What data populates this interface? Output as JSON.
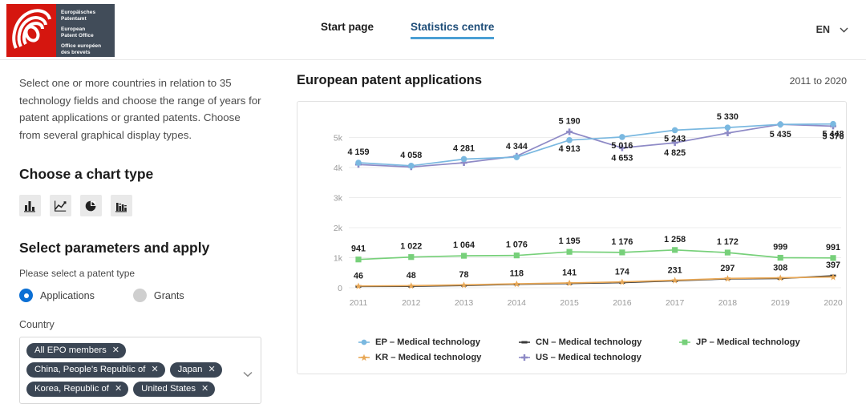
{
  "header": {
    "logo": {
      "line_de": "Europäisches Patentamt",
      "line_en": "European Patent Office",
      "line_fr": "Office européen des brevets",
      "de_1": "Europäisches",
      "de_2": "Patentamt",
      "en_1": "European",
      "en_2": "Patent Office",
      "fr_1": "Office européen",
      "fr_2": "des brevets"
    },
    "nav": [
      {
        "label": "Start page",
        "active": false
      },
      {
        "label": "Statistics centre",
        "active": true
      }
    ],
    "language": {
      "code": "EN",
      "icon": "chevron-down-icon"
    }
  },
  "sidebar": {
    "intro": "Select one or more countries in relation to 35 technology fields and choose the range of years for patent applications or granted patents. Choose from several graphical display types.",
    "chart_type_heading": "Choose a chart type",
    "chart_types": [
      {
        "name": "bar-chart",
        "label": "Bar chart"
      },
      {
        "name": "line-chart",
        "label": "Line chart"
      },
      {
        "name": "pie-chart",
        "label": "Pie chart"
      },
      {
        "name": "grouped-bar-chart",
        "label": "Grouped bar chart"
      }
    ],
    "params_heading": "Select parameters and apply",
    "patent_type_label": "Please select a patent type",
    "patent_types": [
      {
        "label": "Applications",
        "selected": true
      },
      {
        "label": "Grants",
        "selected": false
      }
    ],
    "country_label": "Country",
    "country_tags": [
      [
        "All EPO members"
      ],
      [
        "China, People's Republic of",
        "Japan"
      ],
      [
        "Korea, Republic of",
        "United States"
      ]
    ],
    "tag_remove_icon": "✕",
    "dropdown_icon": "chevron-down-icon"
  },
  "main": {
    "title": "European patent applications",
    "range": "2011 to 2020"
  },
  "chart_data": {
    "type": "line",
    "title": "European patent applications",
    "xlabel": "",
    "ylabel": "",
    "ylim": [
      0,
      5600
    ],
    "grid": true,
    "legend_position": "bottom",
    "x": [
      "2011",
      "2012",
      "2013",
      "2014",
      "2015",
      "2016",
      "2017",
      "2018",
      "2019",
      "2020"
    ],
    "yticks": [
      0,
      1000,
      2000,
      3000,
      4000,
      5000
    ],
    "ytick_labels": [
      "0",
      "1k",
      "2k",
      "3k",
      "4k",
      "5k"
    ],
    "series": [
      {
        "name": "EP – Medical technology",
        "code": "EP",
        "color": "#7ab8e0",
        "marker": "circle",
        "values": [
          4159,
          4058,
          4281,
          4344,
          4913,
          5016,
          5243,
          5330,
          5435,
          5448
        ],
        "labels": [
          "4 159",
          "4 058",
          "4 281",
          "4 344",
          "4 913",
          "5 016",
          "5 243",
          "5 330",
          "5 435",
          "5 448"
        ]
      },
      {
        "name": "CN – Medical technology",
        "code": "CN",
        "color": "#3a3a3a",
        "marker": "dash",
        "values": [
          46,
          48,
          78,
          118,
          141,
          174,
          231,
          297,
          308,
          397
        ],
        "labels": [
          "46",
          "48",
          "78",
          "118",
          "141",
          "174",
          "231",
          "297",
          "308",
          "397"
        ]
      },
      {
        "name": "JP – Medical technology",
        "code": "JP",
        "color": "#77d07a",
        "marker": "square",
        "values": [
          941,
          1022,
          1064,
          1076,
          1195,
          1176,
          1258,
          1172,
          999,
          991
        ],
        "labels": [
          "941",
          "1 022",
          "1 064",
          "1 076",
          "1 195",
          "1 176",
          "1 258",
          "1 172",
          "999",
          "991"
        ]
      },
      {
        "name": "KR – Medical technology",
        "code": "KR",
        "color": "#e8a857",
        "marker": "star",
        "values": [
          60,
          70,
          95,
          130,
          160,
          195,
          250,
          310,
          330,
          360
        ],
        "labels": [
          "",
          "",
          "",
          "",
          "",
          "",
          "",
          "",
          "",
          ""
        ]
      },
      {
        "name": "US – Medical technology",
        "code": "US",
        "color": "#8e8ac6",
        "marker": "cross",
        "values": [
          4100,
          4020,
          4160,
          4380,
          5190,
          4653,
          4825,
          5147,
          5435,
          5376
        ],
        "labels": [
          "",
          "",
          "",
          "",
          "5 190",
          "4 653",
          "4 825",
          "",
          "",
          "5 376"
        ]
      }
    ]
  }
}
